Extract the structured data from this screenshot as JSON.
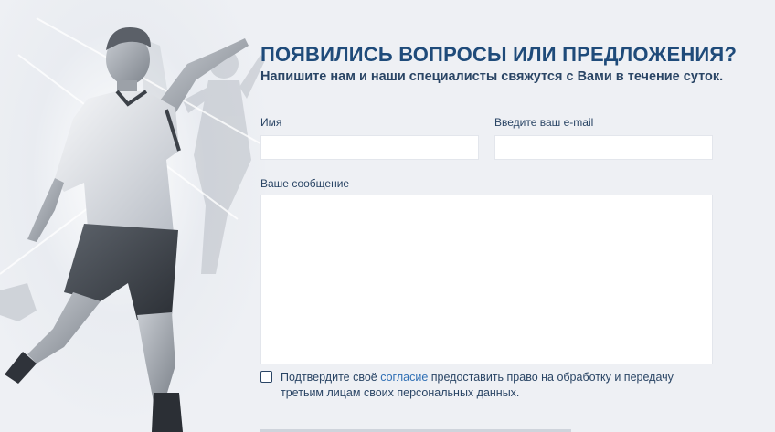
{
  "form": {
    "title": "ПОЯВИЛИСЬ ВОПРОСЫ ИЛИ ПРЕДЛОЖЕНИЯ?",
    "subtitle": "Напишите нам и наши специалисты свяжутся с Вами в течение суток.",
    "name_label": "Имя",
    "name_value": "",
    "email_label": "Введите ваш e-mail",
    "email_value": "",
    "message_label": "Ваше сообщение",
    "message_value": "",
    "consent_before": "Подтвердите своё ",
    "consent_link": "согласие",
    "consent_after": " предоставить право на обработку и передачу третьим лицам своих персональных данных.",
    "consent_checked": false
  },
  "colors": {
    "title": "#1f4b7a",
    "text": "#2a4565",
    "link": "#2f6fb5",
    "background": "#eef0f4"
  },
  "hero": {
    "image": "football-player-photo"
  }
}
